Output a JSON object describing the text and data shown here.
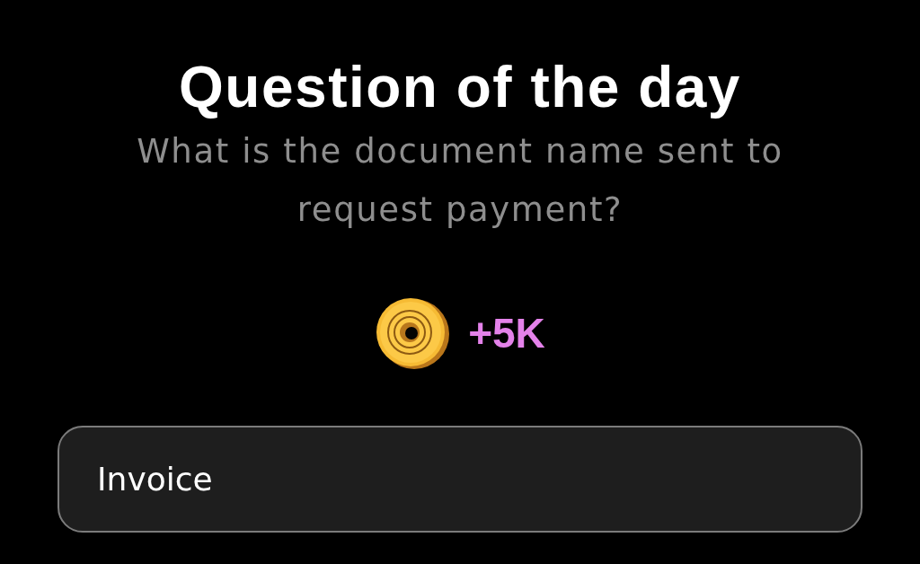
{
  "title": "Question of the day",
  "question": "What is the document name sent to request payment?",
  "reward": {
    "amount": "+5K"
  },
  "answer": {
    "value": "Invoice"
  }
}
